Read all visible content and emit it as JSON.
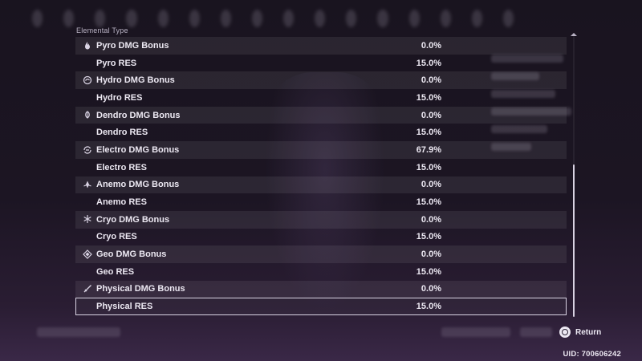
{
  "section_title": "Elemental Type",
  "rows": [
    {
      "label": "Pyro DMG Bonus",
      "value": "0.0%",
      "icon": "pyro-icon",
      "kind": "bonus"
    },
    {
      "label": "Pyro RES",
      "value": "15.0%",
      "icon": "",
      "kind": "res"
    },
    {
      "label": "Hydro DMG Bonus",
      "value": "0.0%",
      "icon": "hydro-icon",
      "kind": "bonus"
    },
    {
      "label": "Hydro RES",
      "value": "15.0%",
      "icon": "",
      "kind": "res"
    },
    {
      "label": "Dendro DMG Bonus",
      "value": "0.0%",
      "icon": "dendro-icon",
      "kind": "bonus"
    },
    {
      "label": "Dendro RES",
      "value": "15.0%",
      "icon": "",
      "kind": "res"
    },
    {
      "label": "Electro DMG Bonus",
      "value": "67.9%",
      "icon": "electro-icon",
      "kind": "bonus"
    },
    {
      "label": "Electro RES",
      "value": "15.0%",
      "icon": "",
      "kind": "res"
    },
    {
      "label": "Anemo DMG Bonus",
      "value": "0.0%",
      "icon": "anemo-icon",
      "kind": "bonus"
    },
    {
      "label": "Anemo RES",
      "value": "15.0%",
      "icon": "",
      "kind": "res"
    },
    {
      "label": "Cryo DMG Bonus",
      "value": "0.0%",
      "icon": "cryo-icon",
      "kind": "bonus"
    },
    {
      "label": "Cryo RES",
      "value": "15.0%",
      "icon": "",
      "kind": "res"
    },
    {
      "label": "Geo DMG Bonus",
      "value": "0.0%",
      "icon": "geo-icon",
      "kind": "bonus"
    },
    {
      "label": "Geo RES",
      "value": "15.0%",
      "icon": "",
      "kind": "res"
    },
    {
      "label": "Physical DMG Bonus",
      "value": "0.0%",
      "icon": "physical-icon",
      "kind": "bonus"
    },
    {
      "label": "Physical RES",
      "value": "15.0%",
      "icon": "",
      "kind": "res",
      "selected": true
    }
  ],
  "return_label": "Return",
  "uid_text": "UID: 700606242",
  "colors": {
    "text": "#ece8f2",
    "row_highlight": "rgba(255,255,255,0.075)",
    "selected_border": "#d9d3e3"
  }
}
